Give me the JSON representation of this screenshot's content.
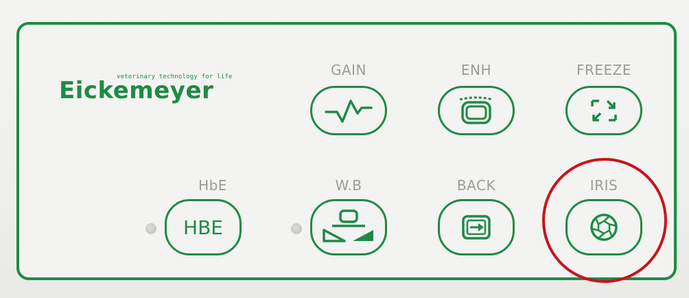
{
  "brand": {
    "name": "Eickemeyer",
    "tagline": "veterinary technology for life",
    "color": "#1f8a46"
  },
  "keys": {
    "gain": {
      "label": "GAIN",
      "icon": "waveform-icon"
    },
    "enh": {
      "label": "ENH",
      "icon": "screen-enhance-icon"
    },
    "freeze": {
      "label": "FREEZE",
      "icon": "collapse-arrows-icon"
    },
    "hbe": {
      "label": "HbE",
      "button_text": "HBE"
    },
    "wb": {
      "label": "W.B",
      "icon": "white-balance-icon"
    },
    "back": {
      "label": "BACK",
      "icon": "return-screen-icon"
    },
    "iris": {
      "label": "IRIS",
      "icon": "aperture-icon"
    }
  },
  "colors": {
    "key_outline": "#1f8a46",
    "label_gray": "#9a9c9a",
    "highlight_ring": "#c4161c"
  }
}
